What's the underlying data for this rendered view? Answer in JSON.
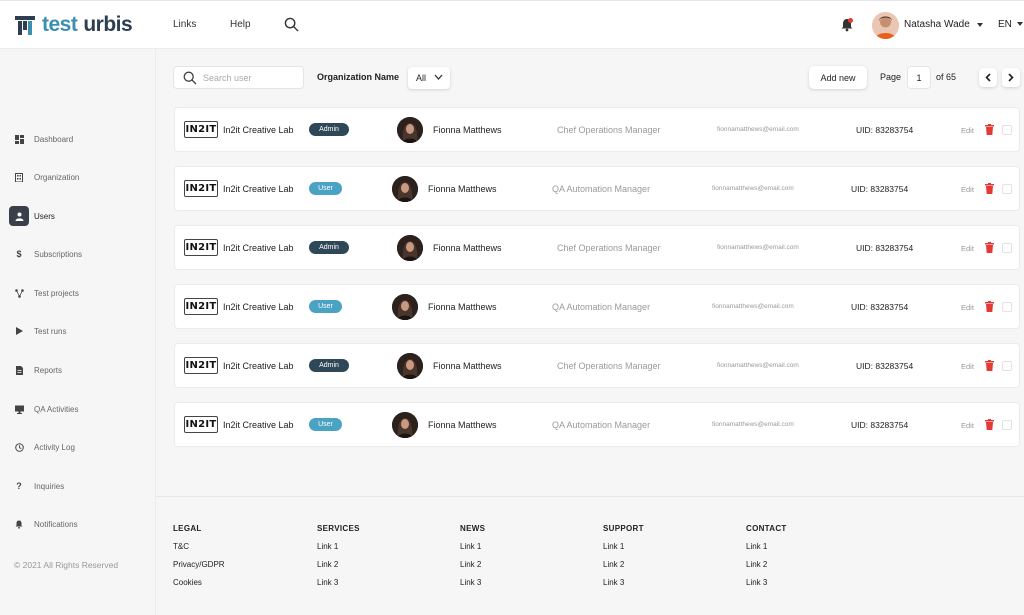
{
  "header": {
    "brand_part1": "test",
    "brand_part2": "urbis",
    "nav": [
      "Links",
      "Help"
    ],
    "user_name": "Natasha Wade",
    "language": "EN"
  },
  "sidebar": {
    "items": [
      {
        "label": "Dashboard",
        "icon": "dashboard-icon",
        "active": false
      },
      {
        "label": "Organization",
        "icon": "building-icon",
        "active": false
      },
      {
        "label": "Users",
        "icon": "user-icon",
        "active": true
      },
      {
        "label": "Subscriptions",
        "icon": "dollar-icon",
        "active": false
      },
      {
        "label": "Test projects",
        "icon": "project-tree-icon",
        "active": false
      },
      {
        "label": "Test runs",
        "icon": "play-icon",
        "active": false
      },
      {
        "label": "Reports",
        "icon": "report-icon",
        "active": false
      },
      {
        "label": "QA Activities",
        "icon": "monitor-icon",
        "active": false
      },
      {
        "label": "Activity Log",
        "icon": "clock-icon",
        "active": false
      },
      {
        "label": "Inquiries",
        "icon": "question-icon",
        "active": false
      },
      {
        "label": "Notifications",
        "icon": "bell-icon",
        "active": false
      }
    ],
    "copyright": "© 2021 All Rights Reserved"
  },
  "toolbar": {
    "search_placeholder": "Search user",
    "org_label": "Organization Name",
    "org_value": "All",
    "add_new": "Add new",
    "page_label": "Page",
    "page_value": "1",
    "page_total": "of 65"
  },
  "users": [
    {
      "org_logo": "IN2IT",
      "org": "In2it Creative Lab",
      "role": "Admin",
      "name": "Fionna Matthews",
      "job": "Chef Operations Manager",
      "email": "fionnamatthews@email.com",
      "uid": "UID: 83283754",
      "edit": "Edit"
    },
    {
      "org_logo": "IN2IT",
      "org": "In2it Creative Lab",
      "role": "User",
      "name": "Fionna Matthews",
      "job": "QA Automation Manager",
      "email": "fionnamatthews@email.com",
      "uid": "UID: 83283754",
      "edit": "Edit"
    },
    {
      "org_logo": "IN2IT",
      "org": "In2it Creative Lab",
      "role": "Admin",
      "name": "Fionna Matthews",
      "job": "Chef Operations Manager",
      "email": "fionnamatthews@email.com",
      "uid": "UID: 83283754",
      "edit": "Edit"
    },
    {
      "org_logo": "IN2IT",
      "org": "In2it Creative Lab",
      "role": "User",
      "name": "Fionna Matthews",
      "job": "QA Automation Manager",
      "email": "fionnamatthews@email.com",
      "uid": "UID: 83283754",
      "edit": "Edit"
    },
    {
      "org_logo": "IN2IT",
      "org": "In2it Creative Lab",
      "role": "Admin",
      "name": "Fionna Matthews",
      "job": "Chef Operations Manager",
      "email": "fionnamatthews@email.com",
      "uid": "UID: 83283754",
      "edit": "Edit"
    },
    {
      "org_logo": "IN2IT",
      "org": "In2it Creative Lab",
      "role": "User",
      "name": "Fionna Matthews",
      "job": "QA Automation Manager",
      "email": "fionnamatthews@email.com",
      "uid": "UID: 83283754",
      "edit": "Edit"
    }
  ],
  "footer": {
    "columns": [
      {
        "heading": "LEGAL",
        "links": [
          "T&C",
          "Privacy/GDPR",
          "Cookies"
        ]
      },
      {
        "heading": "SERVICES",
        "links": [
          "Link 1",
          "Link 2",
          "Link 3"
        ]
      },
      {
        "heading": "NEWS",
        "links": [
          "Link 1",
          "Link 2",
          "Link 3"
        ]
      },
      {
        "heading": "SUPPORT",
        "links": [
          "Link 1",
          "Link 2",
          "Link 3"
        ]
      },
      {
        "heading": "CONTACT",
        "links": [
          "Link 1",
          "Link 2",
          "Link 3"
        ]
      }
    ]
  },
  "colors": {
    "brand_blue": "#3b8fb0",
    "brand_dark": "#2c3e50",
    "admin_badge": "#2f4858",
    "user_badge": "#4aa3c3",
    "delete_red": "#e53935",
    "notification_dot": "#e53935"
  }
}
